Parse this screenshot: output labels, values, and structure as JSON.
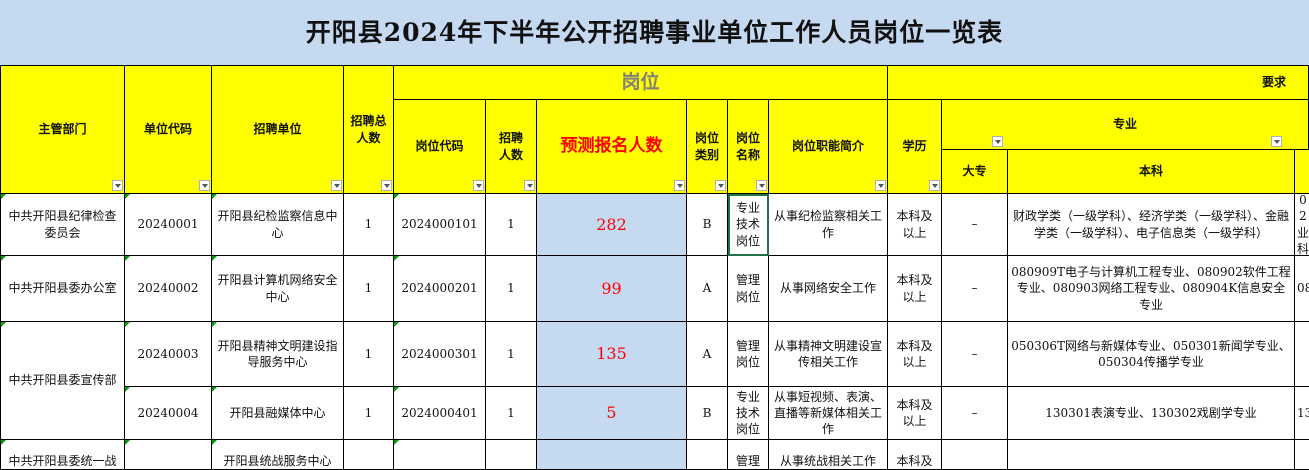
{
  "title": "开阳县2024年下半年公开招聘事业单位工作人员岗位一览表",
  "headers": {
    "dept": "主管部门",
    "unit_code": "单位代码",
    "unit": "招聘单位",
    "total": "招聘总人数",
    "post_group": "岗位",
    "post_code": "岗位代码",
    "post_num": "招聘人数",
    "predicted": "预测报名人数",
    "post_type": "岗位类别",
    "post_name": "岗位名称",
    "post_desc": "岗位职能简介",
    "req_group": "要求",
    "edu": "学历",
    "major_group": "专业",
    "junior": "大专",
    "bachelor": "本科"
  },
  "rows": [
    {
      "dept": "中共开阳县纪律检查委员会",
      "unit_code": "20240001",
      "unit": "开阳县纪检监察信息中心",
      "total": "1",
      "post_code": "2024000101",
      "post_num": "1",
      "predicted": "282",
      "type": "B",
      "post_name": "专业技术岗位",
      "desc": "从事纪检监察相关工作",
      "edu": "本科及以上",
      "junior": "–",
      "bachelor": "财政学类（一级学科）、经济学类（一级学科）、金融学类（一级学科）、电子信息类（一级学科）",
      "overflow": "02 业 科"
    },
    {
      "dept": "中共开阳县委办公室",
      "unit_code": "20240002",
      "unit": "开阳县计算机网络安全中心",
      "total": "1",
      "post_code": "2024000201",
      "post_num": "1",
      "predicted": "99",
      "type": "A",
      "post_name": "管理岗位",
      "desc": "从事网络安全工作",
      "edu": "本科及以上",
      "junior": "–",
      "bachelor": "080909T电子与计算机工程专业、080902软件工程专业、080903网络工程专业、080904K信息安全专业",
      "overflow": "08"
    },
    {
      "dept": "中共开阳县委宣传部",
      "unit_code": "20240003",
      "unit": "开阳县精神文明建设指导服务中心",
      "total": "1",
      "post_code": "2024000301",
      "post_num": "1",
      "predicted": "135",
      "type": "A",
      "post_name": "管理岗位",
      "desc": "从事精神文明建设宣传相关工作",
      "edu": "本科及以上",
      "junior": "–",
      "bachelor": "050306T网络与新媒体专业、050301新闻学专业、050304传播学专业",
      "overflow": ""
    },
    {
      "dept": "",
      "unit_code": "20240004",
      "unit": "开阳县融媒体中心",
      "total": "1",
      "post_code": "2024000401",
      "post_num": "1",
      "predicted": "5",
      "type": "B",
      "post_name": "专业技术岗位",
      "desc": "从事短视频、表演、直播等新媒体相关工作",
      "edu": "本科及以上",
      "junior": "–",
      "bachelor": "130301表演专业、130302戏剧学专业",
      "overflow": "13"
    }
  ],
  "partial_row": {
    "dept": "中共开阳县委统一战",
    "unit": "开阳县统战服务中心",
    "post_name": "管理",
    "desc": "从事统战相关工作",
    "edu": "本科及"
  }
}
